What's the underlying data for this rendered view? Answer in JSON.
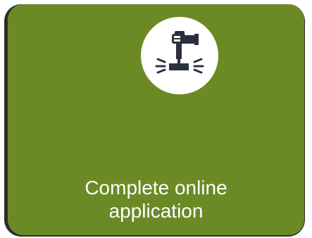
{
  "card": {
    "title_line1": "Complete online",
    "title_line2": "application",
    "icon": "stamp-icon",
    "colors": {
      "card_background": "#6b8a26",
      "icon_background": "#ffffff",
      "icon_color": "#2b3040",
      "text": "#ffffff"
    }
  }
}
